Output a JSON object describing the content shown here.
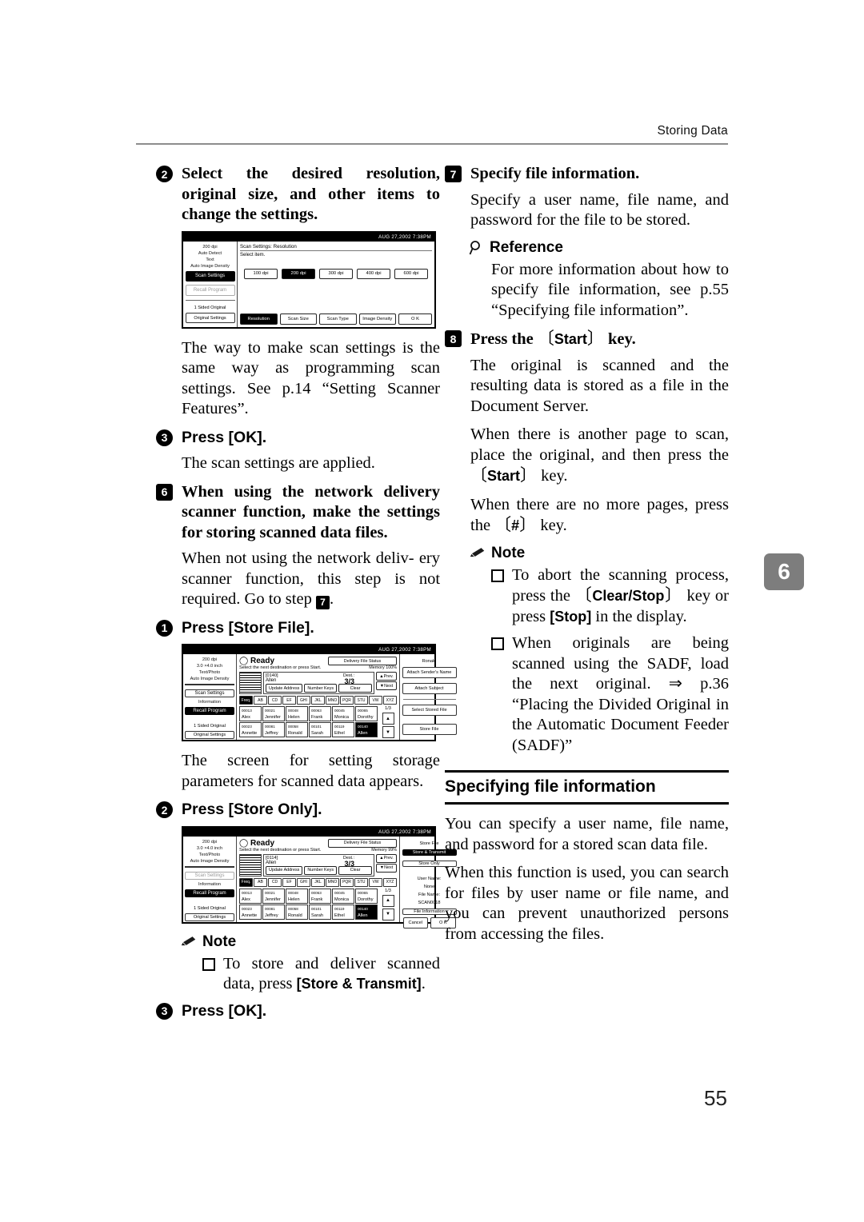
{
  "running_head": "Storing Data",
  "chapter_tab": "6",
  "page_number": "55",
  "left_column": {
    "step2": {
      "num": "2",
      "text": "Select the desired resolution, original size, and other items to change the settings."
    },
    "shot_resolution": {
      "timestamp": "AUG  27,2002  7:38PM",
      "rail": {
        "status_lines": [
          "200 dpi",
          "Auto Detect",
          "Text",
          "Auto Image Density"
        ],
        "scan_settings": "Scan Settings",
        "recall_program": "Recall Program",
        "sided": "1 Sided Original",
        "original_settings": "Original Settings"
      },
      "header": "Scan Settings: Resolution",
      "prompt": "Select item.",
      "resolutions": [
        "100 dpi",
        "200 dpi",
        "300 dpi",
        "400 dpi",
        "600 dpi"
      ],
      "selected_resolution": "200 dpi",
      "tabs": [
        "Resolution",
        "Scan Size",
        "Scan Type",
        "Image Density"
      ],
      "selected_tab": "Resolution",
      "ok": "O K"
    },
    "para_scan_settings": "The way to make scan settings is the same way as programming scan settings. See p.14 “Setting Scanner Features”.",
    "step3": {
      "num": "3",
      "label": "Press [OK]."
    },
    "para_applied": "The scan settings are applied.",
    "step6": {
      "num": "6",
      "text": "When using the network delivery scanner function, make the settings for storing scanned data files."
    },
    "para_not_using_a": "When not using the network deliv-",
    "para_not_using_b": "ery scanner function, this step is",
    "para_not_using_c": "not required. Go to step",
    "para_not_using_d": ".",
    "step_store_file": {
      "num": "1",
      "label": "Press [Store File]."
    },
    "para_screen_storage": "The screen for setting storage parameters for scanned data appears.",
    "step_store_only": {
      "num": "2",
      "label": "Press [Store Only]."
    },
    "note_heading": "Note",
    "note_item": "To store and deliver scanned data, press",
    "note_item_key": "[Store & Transmit]",
    "note_item_end": ".",
    "step_ok": {
      "num": "3",
      "label": "Press [OK]."
    }
  },
  "right_column": {
    "step7": {
      "num": "7",
      "label": "Specify file information."
    },
    "para_specify": "Specify a user name, file name, and password for the file to be stored.",
    "reference_heading": "Reference",
    "reference_text": "For more information about how to specify file information, see p.55 “Specifying file information”.",
    "step8": {
      "num": "8",
      "before": "Press the",
      "key": "Start",
      "after": "key."
    },
    "para_original_scanned": "The original is scanned and the resulting data is stored as a file in the Document Server.",
    "para_another_page_a": "When there is another page to scan, place the original, and then press the",
    "para_another_page_key": "Start",
    "para_another_page_b": "key.",
    "para_no_more_a": "When there are no more pages, press the",
    "para_no_more_key": "#",
    "para_no_more_b": "key.",
    "note_heading": "Note",
    "note_items": [
      {
        "a": "To abort the scanning process, press the",
        "key1": "Clear/Stop",
        "b": "key or press",
        "key2": "[Stop]",
        "c": "in the display."
      },
      {
        "a": "When originals are being scanned using the SADF, load the next original. ⇒ p.36 “Placing the Divided Original in the Automatic Document Feeder (SADF)”"
      }
    ],
    "subsection_title": "Specifying file information",
    "para_you_can_specify": "You can specify a user name, file name, and password for a stored scan data file.",
    "para_when_function": "When this function is used, you can search for files by user name or file name, and you can prevent unauthorized persons from accessing the files."
  },
  "shot_store_file": {
    "timestamp": "AUG  27,2002  7:38PM",
    "rail": {
      "status_lines": [
        "200 dpi",
        "3.0 ×4.0 inch",
        "Text/Photo",
        "Auto Image Density"
      ],
      "scan_settings": "Scan Settings",
      "information": "Information",
      "recall_program": "Recall Program",
      "sided": "1 Sided Original",
      "original_settings": "Original Settings"
    },
    "ready": "Ready",
    "prompt": "Select the next destination or press Start.",
    "delivery_status_btn": "Delivery File Status",
    "memory": "Memory 100%",
    "dest_id": "[0140]",
    "dest_name": "Allen",
    "dest_label": "Dest.:",
    "dest_count": "3/3",
    "update_address": "Update Address",
    "number_keys": "Number Keys",
    "clear": "Clear",
    "prev": "Prev.",
    "next": "Next",
    "alpha_tabs": [
      "Freq.",
      "AB",
      "CD",
      "EF",
      "GHI",
      "JKL",
      "MNO",
      "PQR",
      "STU",
      "VW",
      "XYZ"
    ],
    "alpha_selected": "Freq.",
    "page_indicator": "1/3",
    "destinations": [
      [
        {
          "id": "00013",
          "name": "Alex"
        },
        {
          "id": "00021",
          "name": "Jennifer"
        },
        {
          "id": "00048",
          "name": "Helen"
        },
        {
          "id": "00063",
          "name": "Frank"
        },
        {
          "id": "00045",
          "name": "Monica"
        },
        {
          "id": "00065",
          "name": "Dorothy"
        }
      ],
      [
        {
          "id": "00023",
          "name": "Annette"
        },
        {
          "id": "00081",
          "name": "Jeffrey"
        },
        {
          "id": "00058",
          "name": "Ronald"
        },
        {
          "id": "00101",
          "name": "Sarah"
        },
        {
          "id": "00119",
          "name": "Ethel"
        },
        {
          "id": "00140",
          "name": "Allen",
          "selected": true
        }
      ]
    ],
    "right_rail": {
      "sender": "Ronald",
      "attach_sender": "Attach Sender's Name",
      "attach_subject": "Attach Subject",
      "select_stored_file": "Select Stored File",
      "store_file": "Store File"
    }
  },
  "shot_store_only": {
    "timestamp": "AUG  27,2002  7:38PM",
    "rail": {
      "status_lines": [
        "200 dpi",
        "3.0 ×4.0 inch",
        "Text/Photo",
        "Auto Image Density"
      ],
      "scan_settings": "Scan Settings",
      "information": "Information",
      "recall_program": "Recall Program",
      "sided": "1 Sided Original",
      "original_settings": "Original Settings"
    },
    "ready": "Ready",
    "prompt": "Select the next destination or press Start.",
    "delivery_status_btn": "Delivery File Status",
    "memory": "Memory 99%",
    "dest_id": "[0114]",
    "dest_name": "Allen",
    "dest_label": "Dest.:",
    "dest_count": "3/3",
    "update_address": "Update Address",
    "number_keys": "Number Keys",
    "clear": "Clear",
    "prev": "Prev.",
    "next": "Next",
    "alpha_tabs": [
      "Freq.",
      "AB",
      "CD",
      "EF",
      "GHI",
      "JKL",
      "MNO",
      "PQR",
      "STU",
      "VW",
      "XYZ"
    ],
    "alpha_selected": "Freq.",
    "page_indicator": "1/3",
    "destinations": [
      [
        {
          "id": "00013",
          "name": "Alex"
        },
        {
          "id": "00021",
          "name": "Jennifer"
        },
        {
          "id": "00048",
          "name": "Helen"
        },
        {
          "id": "00063",
          "name": "Frank"
        },
        {
          "id": "00045",
          "name": "Monica"
        },
        {
          "id": "00065",
          "name": "Dorothy"
        }
      ],
      [
        {
          "id": "00023",
          "name": "Annette"
        },
        {
          "id": "00081",
          "name": "Jeffrey"
        },
        {
          "id": "00058",
          "name": "Ronald"
        },
        {
          "id": "00101",
          "name": "Sarah"
        },
        {
          "id": "00119",
          "name": "Ethel"
        },
        {
          "id": "00140",
          "name": "Allen",
          "selected": true
        }
      ]
    ],
    "right_rail": {
      "title": "Store File",
      "store_transmit": "Store & Transmit",
      "store_only": "Store Only",
      "user_name_label": "User Name:",
      "user_name_value": "None",
      "file_name_label": "File Name:",
      "file_name_value": "SCAN0018",
      "file_information": "File Information",
      "cancel": "Cancel",
      "ok": "O K"
    }
  }
}
